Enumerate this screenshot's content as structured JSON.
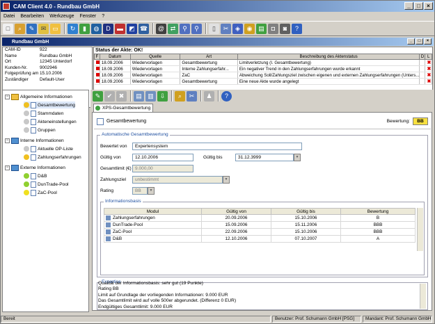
{
  "window": {
    "title": "CAM Client 4.0 - Rundbau GmbH",
    "minimize": "_",
    "maximize": "□",
    "close": "×"
  },
  "menu": [
    "Datei",
    "Bearbeiten",
    "Werkzeuge",
    "Fenster",
    "?"
  ],
  "toolbar_icons": [
    {
      "name": "new-icon",
      "glyph": "□",
      "color": "#f0f0f0"
    },
    {
      "name": "search-icon",
      "glyph": "⌕",
      "color": "#d8a030"
    },
    {
      "name": "pen-icon",
      "glyph": "✎",
      "color": "#3070c0"
    },
    {
      "name": "mail-icon",
      "glyph": "✉",
      "color": "#e0c040"
    },
    {
      "name": "folder-icon",
      "glyph": "▭",
      "color": "#f0c040"
    },
    {
      "name": "refresh-icon",
      "glyph": "↻",
      "color": "#3080d0"
    },
    {
      "name": "chart-icon",
      "glyph": "▮",
      "color": "#40a040"
    },
    {
      "name": "globe-icon",
      "glyph": "◍",
      "color": "#2060a0"
    },
    {
      "name": "dnb-icon",
      "glyph": "D",
      "color": "#203080"
    },
    {
      "name": "card-icon",
      "glyph": "▬",
      "color": "#c03030"
    },
    {
      "name": "bank-icon",
      "glyph": "◩",
      "color": "#2040a0"
    },
    {
      "name": "phone-icon",
      "glyph": "☎",
      "color": "#3060a0"
    },
    {
      "name": "at-icon",
      "glyph": "@",
      "color": "#404040"
    },
    {
      "name": "sync-icon",
      "glyph": "⇄",
      "color": "#40a060"
    },
    {
      "name": "filter-icon",
      "glyph": "⚲",
      "color": "#5070c0"
    },
    {
      "name": "filter2-icon",
      "glyph": "⚲",
      "color": "#5070c0"
    },
    {
      "name": "document-icon",
      "glyph": "▯",
      "color": "#e0e0e0"
    },
    {
      "name": "tools-icon",
      "glyph": "✂",
      "color": "#6080c0"
    },
    {
      "name": "tag-icon",
      "glyph": "◈",
      "color": "#4060c0"
    },
    {
      "name": "money-icon",
      "glyph": "◉",
      "color": "#d0a020"
    },
    {
      "name": "books-icon",
      "glyph": "▤",
      "color": "#40a040"
    },
    {
      "name": "stamp-icon",
      "glyph": "◘",
      "color": "#808080"
    },
    {
      "name": "camera-icon",
      "glyph": "◙",
      "color": "#606060"
    },
    {
      "name": "help-icon",
      "glyph": "?",
      "color": "#3060c0"
    }
  ],
  "mdi": {
    "title": "Rundbau GmbH"
  },
  "info": [
    {
      "k": "CAM-ID",
      "v": "922"
    },
    {
      "k": "Name",
      "v": "Rundbau GmbH"
    },
    {
      "k": "Ort",
      "v": "12345 Unterdorf"
    },
    {
      "k": "Kunden-Nr.",
      "v": "9002946"
    },
    {
      "k": "Folgeprüfung am",
      "v": "15.10.2006"
    },
    {
      "k": "Zuständiger",
      "v": "Default-User"
    }
  ],
  "status": {
    "title": "Status der Akte: OK!",
    "headers": [
      "F",
      "Datum",
      "Quelle",
      "Art",
      "Beschreibung des Aktenstatus",
      "D",
      "L"
    ],
    "rows": [
      {
        "datum": "18.09.2006",
        "quelle": "Wiedervorlagen",
        "art": "Gesamtbewertung",
        "beschreibung": "Limitverletzung (I. Gesamtbewertung)"
      },
      {
        "datum": "18.09.2006",
        "quelle": "Wiedervorlagen",
        "art": "Interne Zahlungserfahr...",
        "beschreibung": "Ein negativer Trend in den Zahlungserfahrungen wurde erkannt"
      },
      {
        "datum": "18.09.2006",
        "quelle": "Wiedervorlagen",
        "art": "ZaC",
        "beschreibung": "Abweichung Soll/Zahlungsziel zwischen eigenen und externen Zahlungserfahrungen (Unters..."
      },
      {
        "datum": "18.09.2006",
        "quelle": "Wiedervorlagen",
        "art": "Gesamtbewertung",
        "beschreibung": "Eine neue Akte wurde angelegt"
      }
    ]
  },
  "tree": {
    "g1": "Allgemeine Informationen",
    "g1_items": [
      "Gesamtbewertung",
      "Stammdaten",
      "Akteneinstellungen",
      "Gruppen"
    ],
    "g2": "Interne Informationen",
    "g2_items": [
      "Aktuelle OP-Liste",
      "Zahlungserfahrungen"
    ],
    "g3": "Externe Informationen",
    "g3_items": [
      "D&B",
      "DunTrade-Pool",
      "ZaC-Pool"
    ]
  },
  "tab": {
    "label": "XPS-Gesamtbewertung"
  },
  "header": {
    "title": "Gesamtbewertung",
    "rating_label": "Bewertung:",
    "rating_value": "BB"
  },
  "auto": {
    "group_label": "Automatische Gesamtbewertung",
    "bewertet_von_label": "Bewertet von",
    "bewertet_von": "Expertensystem",
    "gueltig_von_label": "Gültig von",
    "gueltig_von": "12.10.2006",
    "gueltig_bis_label": "Gültig bis",
    "gueltig_bis": "31.12.3999",
    "gesamtlimit_label": "Gesamtlimit (€)",
    "gesamtlimit": "9.000,00",
    "zahlungsziel_label": "Zahlungsziel",
    "zahlungsziel": "unbestimmt",
    "rating_label": "Rating",
    "rating": "BB"
  },
  "infobasis": {
    "group_label": "Informationsbasis",
    "headers": [
      "Modul",
      "Gültig von",
      "Gültig bis",
      "Bewertung"
    ],
    "rows": [
      {
        "modul": "Zahlungserfahrungen",
        "von": "20.09.2006",
        "bis": "15.10.2006",
        "bew": "B"
      },
      {
        "modul": "DunTrade-Pool",
        "von": "15.09.2006",
        "bis": "15.11.2006",
        "bew": "BBB"
      },
      {
        "modul": "ZaC-Pool",
        "von": "22.09.2006",
        "bis": "15.10.2006",
        "bew": "BBB"
      },
      {
        "modul": "D&B",
        "von": "12.10.2006",
        "bis": "07.10.2007",
        "bew": "A"
      }
    ]
  },
  "expertise": {
    "group_label": "Expertise",
    "lines": [
      "Qualität der Informationsbasis: sehr gut (19 Punkte)",
      "Rating BB",
      "Limit auf Grundlage der vorliegenden Informationen: 9.000 EUR",
      "Das Gesamtlimit wird auf volle 500er abgerundet. (Differenz 0 EUR)",
      "Endgültiges Gesamtlimit: 9.000 EUR"
    ]
  },
  "statusbar": {
    "left": "Bereit",
    "user": "Benutzer: Prof. Schumann GmbH [PSG]",
    "mandant": "Mandant: Prof. Schumann GmbH"
  },
  "colors": {
    "accent": "#0a246a",
    "rating": "#f8e040",
    "alert": "#d00000"
  }
}
